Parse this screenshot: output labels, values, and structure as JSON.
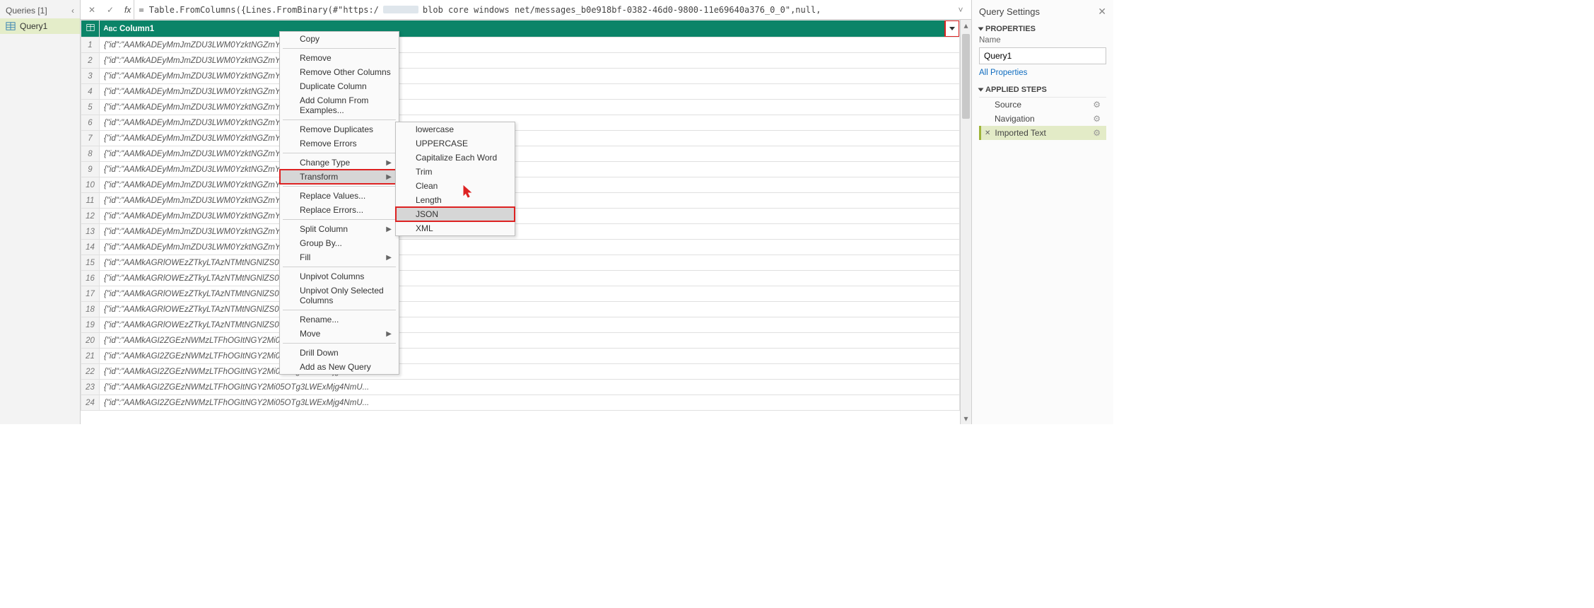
{
  "queries": {
    "title": "Queries [1]",
    "items": [
      "Query1"
    ]
  },
  "formula_bar": {
    "fx": "fx",
    "formula_pre": "= Table.FromColumns({Lines.FromBinary(#\"https:/",
    "formula_post": "blob core windows net/messages_b0e918bf-0382-46d0-9800-11e69640a376_0_0\",null,"
  },
  "grid": {
    "column_header": "Column1",
    "rows": [
      "{\"id\":\"AAMkADEyMmJmZDU3LWM0YzktNGZmYS1hNGM1LWYyYmU2...",
      "{\"id\":\"AAMkADEyMmJmZDU3LWM0YzktNGZmYS1hNGM1LWYyYmU2...",
      "{\"id\":\"AAMkADEyMmJmZDU3LWM0YzktNGZmYS1hNGM1LWYyYmU2...",
      "{\"id\":\"AAMkADEyMmJmZDU3LWM0YzktNGZmYS1hNGM1LWYyYmU2...",
      "{\"id\":\"AAMkADEyMmJmZDU3LWM0YzktNGZmYS1hNGM1LWYyYmU2...",
      "{\"id\":\"AAMkADEyMmJmZDU3LWM0YzktNGZmYS1hNGM1LWYyYmU2...",
      "{\"id\":\"AAMkADEyMmJmZDU3LWM0YzktNGZmYS1hNGM1LWYyYmU2...",
      "{\"id\":\"AAMkADEyMmJmZDU3LWM0YzktNGZmYS1hNGM1LWYyYmU2...",
      "{\"id\":\"AAMkADEyMmJmZDU3LWM0YzktNGZmYS1hNGM1LWYyYmU2...",
      "{\"id\":\"AAMkADEyMmJmZDU3LWM0YzktNGZmYS1hNGM1LWYyYmU2...",
      "{\"id\":\"AAMkADEyMmJmZDU3LWM0YzktNGZmYS1hNGM1LWYyYmU2...",
      "{\"id\":\"AAMkADEyMmJmZDU3LWM0YzktNGZmYS1hNGM1LWYyYmU2...",
      "{\"id\":\"AAMkADEyMmJmZDU3LWM0YzktNGZmYS1hNGM1LWYyYmU2...",
      "{\"id\":\"AAMkADEyMmJmZDU3LWM0YzktNGZmYS1hNGM1LWYyYmU2...",
      "{\"id\":\"AAMkAGRlOWEzZTkyLTAzNTMtNGNlZS04YTRlLWEwZWM3ODk...",
      "{\"id\":\"AAMkAGRlOWEzZTkyLTAzNTMtNGNlZS04YTRlLWEwZWM3ODk...",
      "{\"id\":\"AAMkAGRlOWEzZTkyLTAzNTMtNGNlZS04YTRlLWEwZWM3ODk...",
      "{\"id\":\"AAMkAGRlOWEzZTkyLTAzNTMtNGNlZS04YTRlLWEwZWM3ODk...",
      "{\"id\":\"AAMkAGRlOWEzZTkyLTAzNTMtNGNlZS04YTRlLWEwZWM3ODk...",
      "{\"id\":\"AAMkAGI2ZGEzNWMzLTFhOGItNGY2Mi05OTg3LWExMjg4NmU...",
      "{\"id\":\"AAMkAGI2ZGEzNWMzLTFhOGItNGY2Mi05OTg3LWExMjg4NmU...",
      "{\"id\":\"AAMkAGI2ZGEzNWMzLTFhOGItNGY2Mi05OTg3LWExMjg4NmU...",
      "{\"id\":\"AAMkAGI2ZGEzNWMzLTFhOGItNGY2Mi05OTg3LWExMjg4NmU...",
      "{\"id\":\"AAMkAGI2ZGEzNWMzLTFhOGItNGY2Mi05OTg3LWExMjg4NmU..."
    ]
  },
  "context_menu": {
    "items": [
      {
        "label": "Copy"
      },
      {
        "label": "Remove"
      },
      {
        "label": "Remove Other Columns"
      },
      {
        "label": "Duplicate Column"
      },
      {
        "label": "Add Column From Examples..."
      },
      {
        "label": "Remove Duplicates"
      },
      {
        "label": "Remove Errors"
      },
      {
        "label": "Change Type",
        "sub": true
      },
      {
        "label": "Transform",
        "sub": true,
        "hi": true,
        "red": true
      },
      {
        "label": "Replace Values..."
      },
      {
        "label": "Replace Errors..."
      },
      {
        "label": "Split Column",
        "sub": true
      },
      {
        "label": "Group By..."
      },
      {
        "label": "Fill",
        "sub": true
      },
      {
        "label": "Unpivot Columns"
      },
      {
        "label": "Unpivot Only Selected Columns"
      },
      {
        "label": "Rename..."
      },
      {
        "label": "Move",
        "sub": true
      },
      {
        "label": "Drill Down"
      },
      {
        "label": "Add as New Query"
      }
    ]
  },
  "submenu": {
    "items": [
      {
        "label": "lowercase"
      },
      {
        "label": "UPPERCASE"
      },
      {
        "label": "Capitalize Each Word"
      },
      {
        "label": "Trim"
      },
      {
        "label": "Clean"
      },
      {
        "label": "Length"
      },
      {
        "label": "JSON",
        "hi": true,
        "red": true
      },
      {
        "label": "XML"
      }
    ]
  },
  "settings": {
    "title": "Query Settings",
    "properties_label": "PROPERTIES",
    "name_label": "Name",
    "name_value": "Query1",
    "all_props": "All Properties",
    "applied_label": "APPLIED STEPS",
    "steps": [
      {
        "label": "Source",
        "gear": true
      },
      {
        "label": "Navigation",
        "gear": true
      },
      {
        "label": "Imported Text",
        "selected": true
      }
    ]
  }
}
